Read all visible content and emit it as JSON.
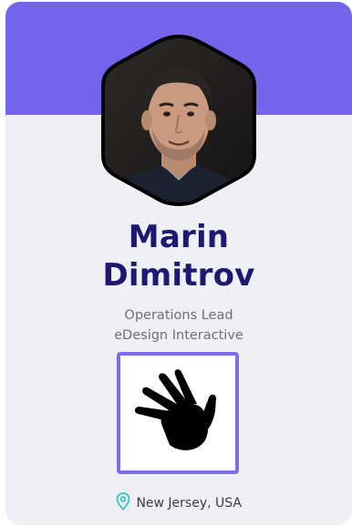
{
  "profile": {
    "first_name": "Marin",
    "last_name": "Dimitrov",
    "title": "Operations Lead",
    "company": "eDesign Interactive",
    "location": "New Jersey, USA"
  },
  "colors": {
    "header": "#7364eb",
    "name": "#1f1870",
    "accent": "#7b6cf0",
    "pin": "#2fc7b9"
  },
  "icons": {
    "avatar": "avatar-photo-hexagon",
    "hand": "hand-icon",
    "location": "location-pin-icon"
  }
}
